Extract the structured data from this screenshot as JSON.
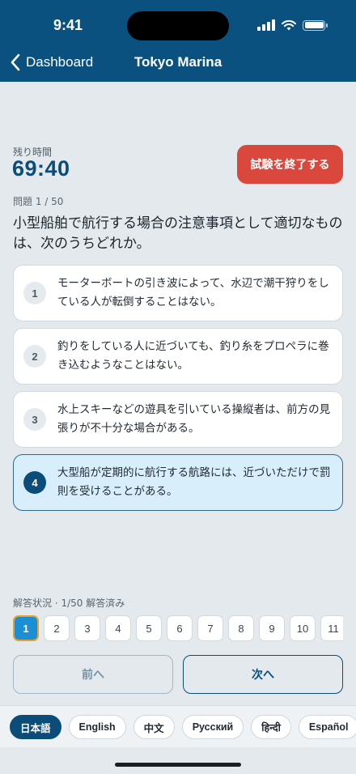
{
  "status_bar": {
    "time": "9:41"
  },
  "nav": {
    "back_label": "Dashboard",
    "title": "Tokyo Marina"
  },
  "timer": {
    "label": "残り時間",
    "value": "69:40"
  },
  "end_button": "試験を終了する",
  "question": {
    "counter": "問題 1 / 50",
    "text": "小型船舶で航行する場合の注意事項として適切なものは、次のうちどれか。"
  },
  "options": [
    {
      "number": "1",
      "text": "モーターボートの引き波によって、水辺で潮干狩りをしている人が転倒することはない。"
    },
    {
      "number": "2",
      "text": "釣りをしている人に近づいても、釣り糸をプロペラに巻き込むようなことはない。"
    },
    {
      "number": "3",
      "text": "水上スキーなどの遊具を引いている操縦者は、前方の見張りが不十分な場合がある。"
    },
    {
      "number": "4",
      "text": "大型船が定期的に航行する航路には、近づいただけで罰則を受けることがある。"
    }
  ],
  "selected_option": "4",
  "progress": {
    "label": "解答状況 · 1/50 解答済み",
    "current": "1",
    "buttons": [
      "1",
      "2",
      "3",
      "4",
      "5",
      "6",
      "7",
      "8",
      "9",
      "10",
      "11"
    ]
  },
  "prev_button": "前へ",
  "next_button": "次へ",
  "languages": [
    "日本語",
    "English",
    "中文",
    "Русский",
    "हिन्दी",
    "Español"
  ],
  "active_language": "日本語",
  "colors": {
    "header": "#0b5180",
    "accent": "#0b4d78",
    "danger": "#d9473d",
    "current_question": "#1b8fd6",
    "selected_option_bg": "#d8effb"
  }
}
